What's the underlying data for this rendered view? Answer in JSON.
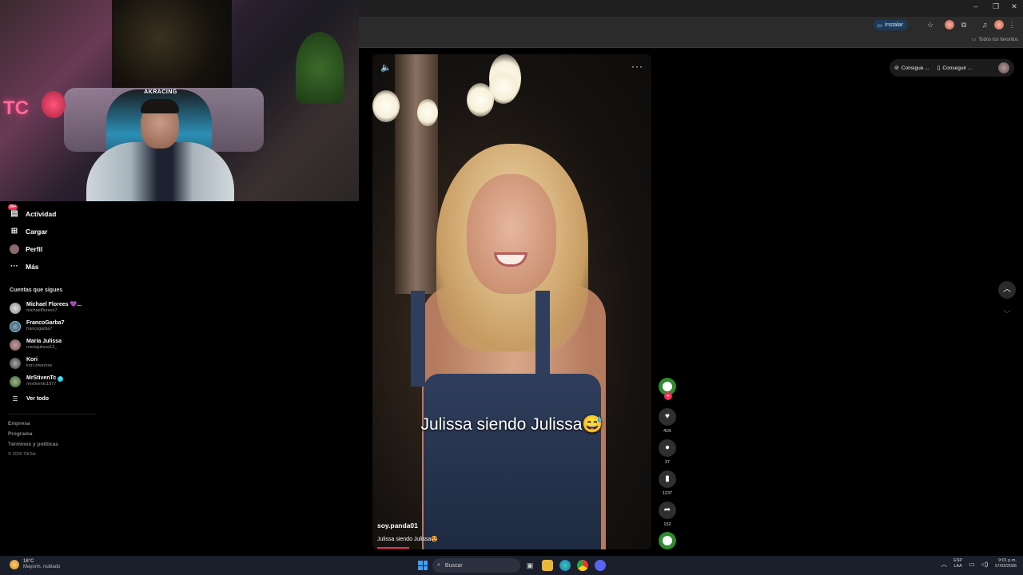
{
  "browser": {
    "install_label": "Instalar",
    "favorites_label": "Todos los favoritos"
  },
  "sidebar": {
    "nav": [
      {
        "label": "Actividad",
        "badge": "99+"
      },
      {
        "label": "Cargar"
      },
      {
        "label": "Perfil"
      },
      {
        "label": "Más"
      }
    ],
    "following_title": "Cuentas que sigues",
    "accounts": [
      {
        "name": "Michael Florees 💜...",
        "user": "michaelflorees7"
      },
      {
        "name": "FrancoGarba7",
        "user": "francogarba7"
      },
      {
        "name": "Maria Julissa",
        "user": "mariajulissa13_"
      },
      {
        "name": "Kori",
        "user": "kori.oliveross"
      },
      {
        "name": "MrStivenTc",
        "user": "mrstiventc1977"
      }
    ],
    "see_all": "Ver todo",
    "footer": [
      "Empresa",
      "Programa",
      "Términos y políticas"
    ],
    "copyright": "© 2026 TikTok"
  },
  "webcam": {
    "chair_brand": "AKRACING",
    "sign_text": "TC"
  },
  "video": {
    "caption": "Julissa siendo Julissa😅",
    "author": "soy.panda01",
    "description": "Julissa siendo Julissa😍",
    "progress": 0.12
  },
  "actions": {
    "likes": "41K",
    "comments": "37",
    "saves": "1237",
    "shares": "152"
  },
  "chips": {
    "consigue": "Consigue ...",
    "conseguir": "Conseguir ..."
  },
  "taskbar": {
    "temp": "18°C",
    "weather": "Mayorm. nublado",
    "search": "Buscar",
    "lang1": "ESP",
    "lang2": "LAA",
    "time": "9:01 p.m.",
    "date": "17/03/2026"
  },
  "colors": {
    "accent": "#fe2c55",
    "verified": "#20d5ec",
    "taskbar": "#1a1f2b"
  }
}
